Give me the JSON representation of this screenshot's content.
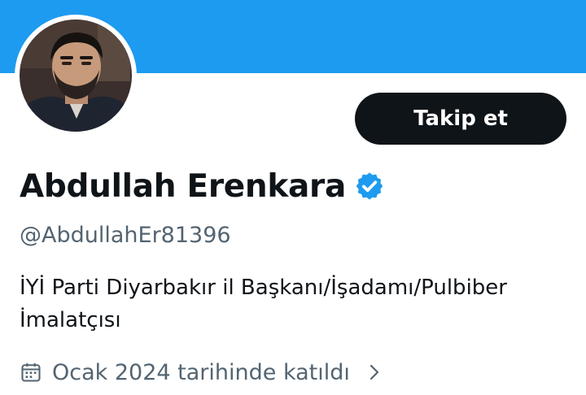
{
  "profile": {
    "display_name": "Abdullah Erenkara",
    "handle": "@AbdullahEr81396",
    "bio_line1": "İYİ Parti Diyarbakır il Başkanı/İşadamı/Pulbiber",
    "bio_line2": "İmalatçısı",
    "joined": "Ocak 2024 tarihinde katıldı",
    "verified": true
  },
  "actions": {
    "follow_label": "Takip et"
  },
  "icons": {
    "avatar": "profile-photo",
    "verified": "verified-badge-icon",
    "calendar": "calendar-icon",
    "chevron": "chevron-right-icon"
  },
  "colors": {
    "banner": "#1d9bf0",
    "follow_button": "#0f1419",
    "verified": "#1d9bf0",
    "text_primary": "#0f1419",
    "text_secondary": "#536471"
  }
}
